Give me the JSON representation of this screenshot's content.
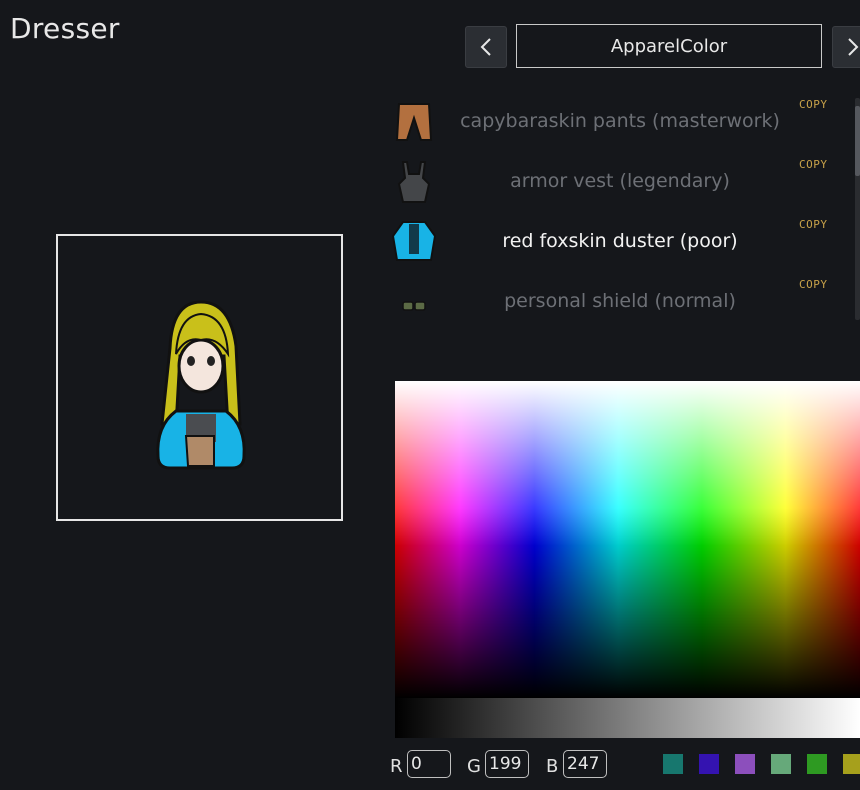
{
  "window": {
    "title": "Dresser"
  },
  "header": {
    "category_label": "ApparelColor",
    "prev_icon": "chevron-left-icon",
    "next_icon": "chevron-right-icon"
  },
  "apparel": [
    {
      "label": "capybaraskin pants (masterwork)",
      "copy": "COPY",
      "active": false,
      "icon": "pants-icon"
    },
    {
      "label": "armor vest (legendary)",
      "copy": "COPY",
      "active": false,
      "icon": "armor-vest-icon"
    },
    {
      "label": "red foxskin duster (poor)",
      "copy": "COPY",
      "active": true,
      "icon": "duster-icon"
    },
    {
      "label": "personal shield (normal)",
      "copy": "COPY",
      "active": false,
      "icon": "shield-belt-icon"
    }
  ],
  "color": {
    "r_label": "R",
    "g_label": "G",
    "b_label": "B",
    "r": "0",
    "g": "199",
    "b": "247"
  },
  "swatches": [
    "#17776e",
    "#3413b0",
    "#8c4fbc",
    "#66a97a",
    "#2e9a22",
    "#a6a01c"
  ]
}
